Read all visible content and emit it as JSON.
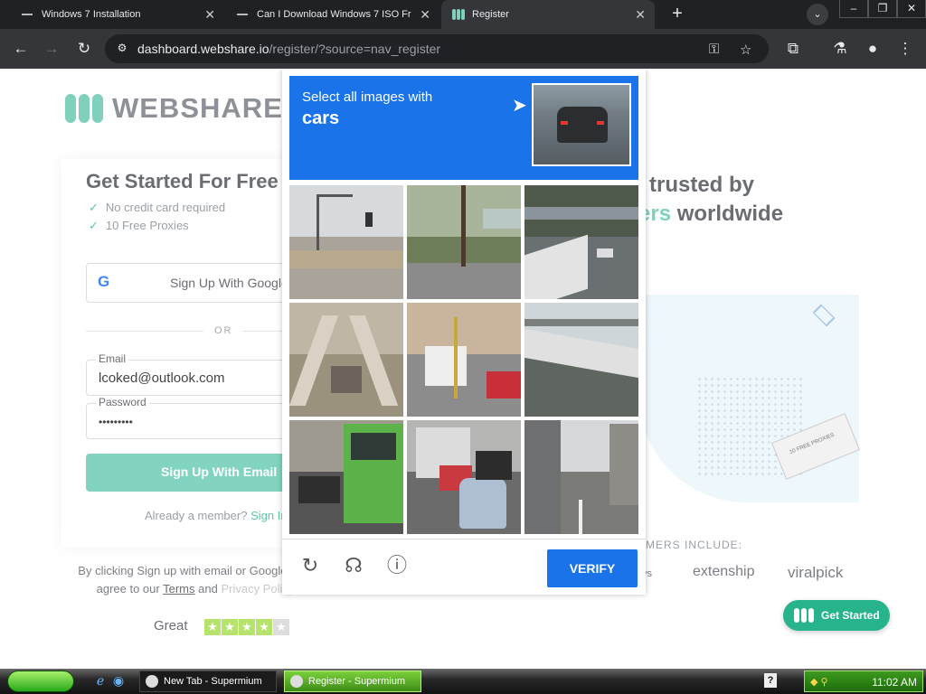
{
  "browser": {
    "tabs": [
      {
        "title": "Windows 7 Installation"
      },
      {
        "title": "Can I Download Windows 7 ISO Fr"
      },
      {
        "title": "Register"
      }
    ],
    "new_tab_glyph": "+",
    "url_host": "dashboard.webshare.io",
    "url_path": "/register/?source=nav_register",
    "icons": [
      "back-icon",
      "forward-icon",
      "reload-icon",
      "site-info-icon",
      "key-icon",
      "star-icon",
      "extensions-icon",
      "labs-icon",
      "profile-icon",
      "menu-icon"
    ]
  },
  "page": {
    "logo_text": "WEBSHARE",
    "title": "Get Started For Free",
    "checks": [
      "No credit card required",
      "10 Free Proxies"
    ],
    "google_button": "Sign Up With Google",
    "or": "OR",
    "email_label": "Email",
    "email_value": "lcoked@outlook.com",
    "password_label": "Password",
    "password_value": "•••••••••",
    "submit": "Sign Up With Email",
    "already_text": "Already a member?",
    "already_link": "Sign In",
    "terms_prefix": "By clicking Sign up with email or Google, you agree to our",
    "terms_link": "Terms",
    "terms_and": "and",
    "privacy_link": "Privacy Policy",
    "rating_word": "Great",
    "stars_filled": 4,
    "stars_total": 5,
    "trusted_line1": "trusted by",
    "trusted_accent": "ers",
    "trusted_rest": "worldwide",
    "hero_box_text": "10 FREE PROXIES",
    "customers_label": "MERS INCLUDE:",
    "brands": [
      "ys",
      "extenship",
      "viralpick"
    ],
    "cta": "Get Started",
    "accent_color": "#7fd1bd",
    "cta_color": "#27b38b"
  },
  "captcha": {
    "instruction": "Select all images with",
    "target": "cars",
    "verify": "VERIFY",
    "tiles": [
      "street-light-tile",
      "road-trees-tile",
      "highway-overpass-tile",
      "stairs-tile",
      "truck-street-tile",
      "bridge-road-tile",
      "bus-traffic-tile",
      "traffic-cars-tile",
      "city-street-tile"
    ],
    "header_color": "#1a73e8"
  },
  "taskbar": {
    "tasks": [
      "New Tab - Supermium",
      "Register - Supermium"
    ],
    "clock": "11:02 AM"
  }
}
